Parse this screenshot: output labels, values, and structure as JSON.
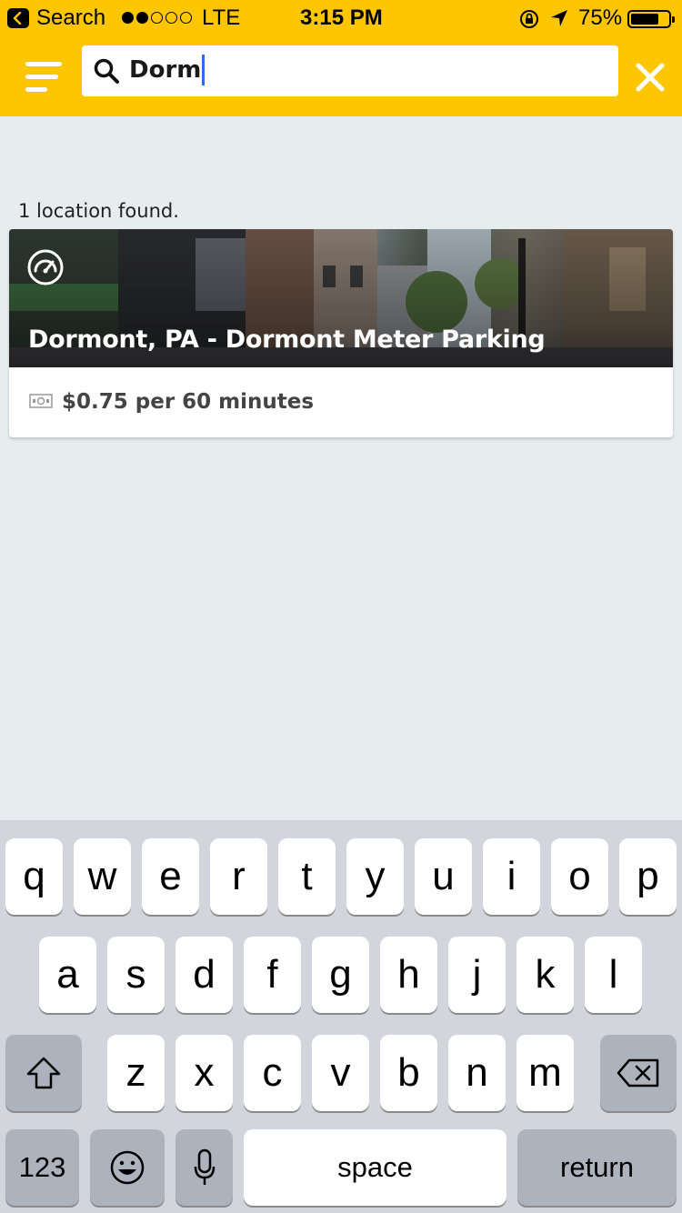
{
  "status_bar": {
    "back_label": "Search",
    "carrier": "LTE",
    "time": "3:15 PM",
    "battery": "75%",
    "battery_level": 0.75,
    "signal_strength": 2
  },
  "search": {
    "query": "Dorm"
  },
  "results": {
    "count_text": "1 location found.",
    "items": [
      {
        "title": "Dormont, PA - Dormont Meter Parking",
        "price": "$0.75 per 60 minutes"
      }
    ]
  },
  "keyboard": {
    "row1": [
      "q",
      "w",
      "e",
      "r",
      "t",
      "y",
      "u",
      "i",
      "o",
      "p"
    ],
    "row2": [
      "a",
      "s",
      "d",
      "f",
      "g",
      "h",
      "j",
      "k",
      "l"
    ],
    "row3": [
      "z",
      "x",
      "c",
      "v",
      "b",
      "n",
      "m"
    ],
    "numbers_label": "123",
    "space_label": "space",
    "return_label": "return"
  },
  "colors": {
    "brand_yellow": "#fec600",
    "background": "#e7ecef",
    "caret": "#2a6cf0"
  }
}
